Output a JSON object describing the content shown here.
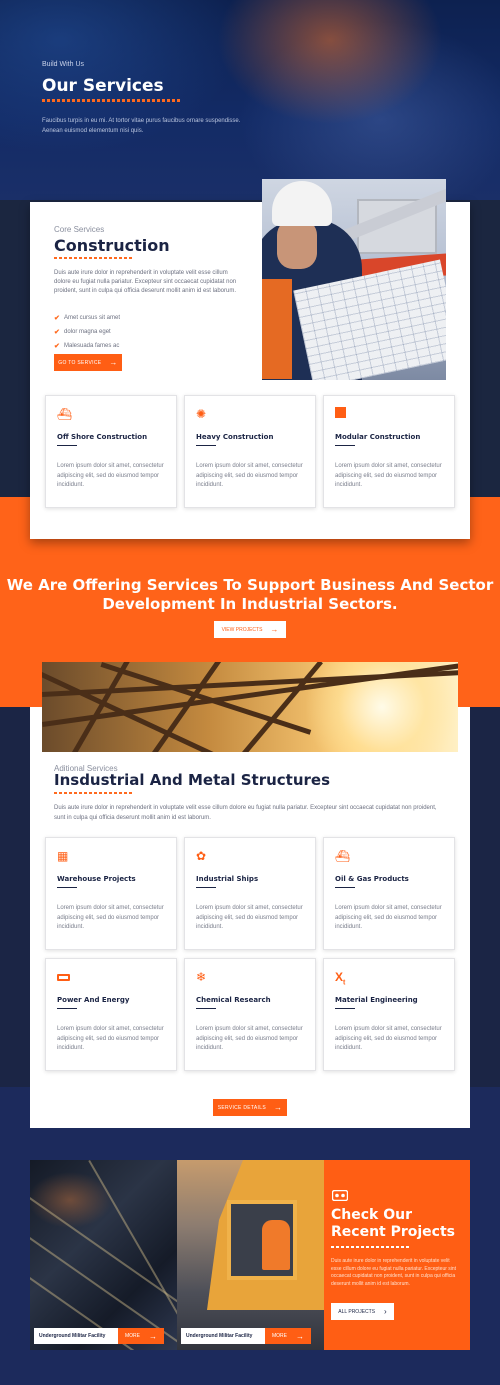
{
  "hero": {
    "kicker": "Build With Us",
    "title": "Our Services",
    "description": "Faucibus turpis in eu mi. At tortor vitae purus faucibus ornare suspendisse. Aenean euismod elementum nisi quis."
  },
  "core": {
    "kicker": "Core Services",
    "title": "Construction",
    "description": "Duis aute irure dolor in reprehenderit in voluptate velit esse cillum dolore eu fugiat nulla pariatur. Excepteur sint occaecat cupidatat non proident, sunt in culpa qui officia deserunt mollit anim id est laborum.",
    "list": [
      "Amet cursus sit amet",
      "dolor magna eget",
      "Malesuada fames ac"
    ],
    "button": "GO TO SERVICE",
    "tiles": [
      {
        "icon": "ship-icon",
        "title": "Off Shore Construction",
        "text": "Lorem ipsum dolor sit amet, consectetur adipiscing elit, sed do eiusmod tempor incididunt."
      },
      {
        "icon": "gear-icon",
        "title": "Heavy Construction",
        "text": "Lorem ipsum dolor sit amet, consectetur adipiscing elit, sed do eiusmod tempor incididunt."
      },
      {
        "icon": "square-icon",
        "title": "Modular Construction",
        "text": "Lorem ipsum dolor sit amet, consectetur adipiscing elit, sed do eiusmod tempor incididunt."
      }
    ]
  },
  "banner": {
    "title": "We Are Offering Services To Support Business And Sector Development In Industrial Sectors.",
    "button": "VIEW PROJECTS"
  },
  "additional": {
    "kicker": "Aditional Services",
    "title": "Insdustrial And Metal Structures",
    "description": "Duis aute irure dolor in reprehenderit in voluptate velit esse cillum dolore eu fugiat nulla pariatur. Excepteur sint occaecat cupidatat non proident, sunt in culpa qui officia deserunt mollit anim id est laborum.",
    "tiles": [
      {
        "icon": "grid-icon",
        "title": "Warehouse Projects",
        "text": "Lorem ipsum dolor sit amet, consectetur adipiscing elit, sed do eiusmod tempor incididunt."
      },
      {
        "icon": "puzzle-icon",
        "title": "Industrial Ships",
        "text": "Lorem ipsum dolor sit amet, consectetur adipiscing elit, sed do eiusmod tempor incididunt."
      },
      {
        "icon": "oil-ship-icon",
        "title": "Oil & Gas Products",
        "text": "Lorem ipsum dolor sit amet, consectetur adipiscing elit, sed do eiusmod tempor incididunt."
      },
      {
        "icon": "battery-icon",
        "title": "Power And Energy",
        "text": "Lorem ipsum dolor sit amet, consectetur adipiscing elit, sed do eiusmod tempor incididunt."
      },
      {
        "icon": "snowflake-icon",
        "title": "Chemical Research",
        "text": "Lorem ipsum dolor sit amet, consectetur adipiscing elit, sed do eiusmod tempor incididunt."
      },
      {
        "icon": "element-icon",
        "title": "Material Engineering",
        "text": "Lorem ipsum dolor sit amet, consectetur adipiscing elit, sed do eiusmod tempor incididunt."
      }
    ],
    "button": "SERVICE DETAILS"
  },
  "projects": {
    "items": [
      {
        "label": "Underground Militar Facility",
        "more": "MORE"
      },
      {
        "label": "Underground Militar Facility",
        "more": "MORE"
      }
    ],
    "cta": {
      "icon": "vr-headset-icon",
      "title": "Check Our Recent Projects",
      "description": "Duis aute irure dolor in reprehenderit in voluptate velit esse cillum dolore eu fugiat nulla pariatur. Excepteur sint occaecat cupidatat non proident, sunt in culpa qui officia deserunt mollit anim id est laborum.",
      "button": "ALL PROJECTS"
    }
  },
  "colors": {
    "accent": "#ff5e14",
    "navy": "#1b2444"
  }
}
